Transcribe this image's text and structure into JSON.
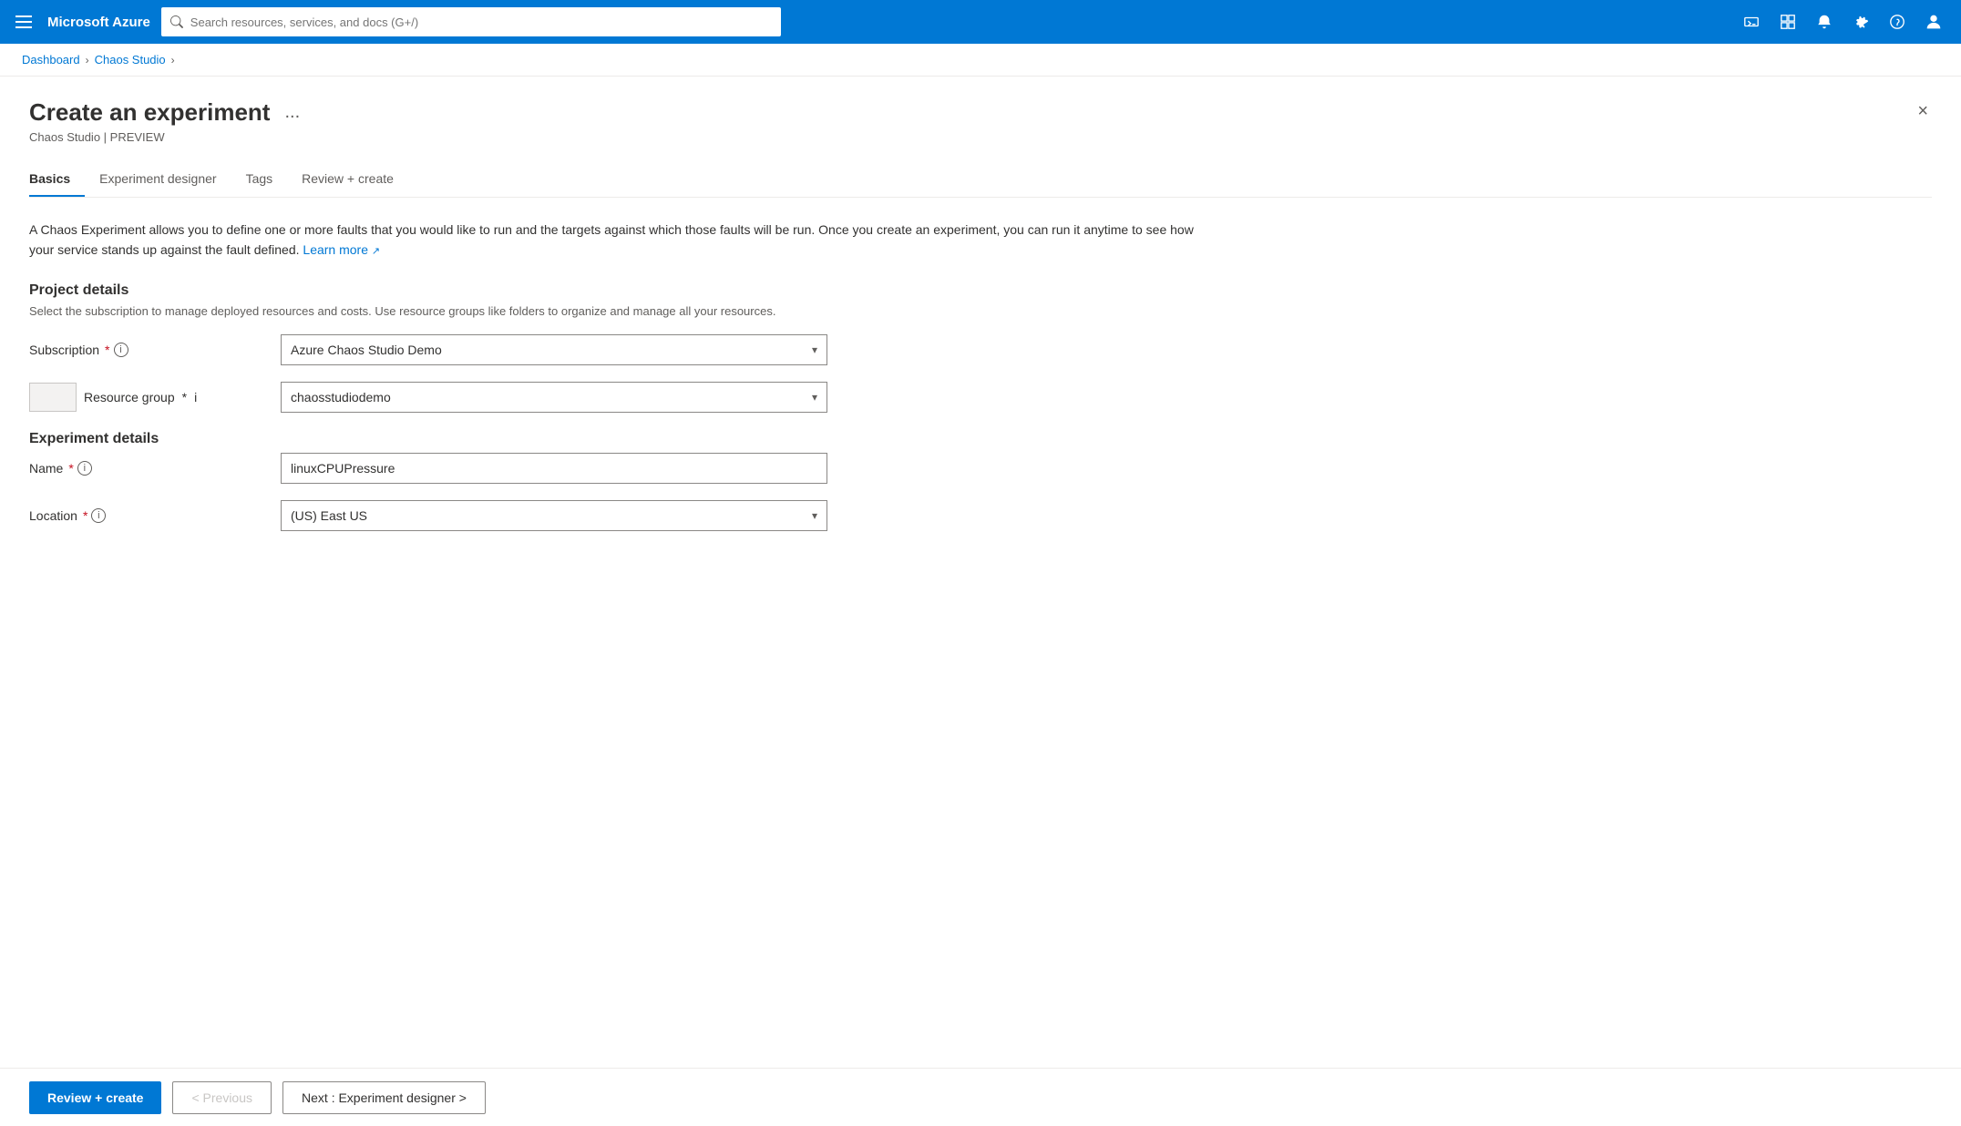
{
  "topnav": {
    "brand": "Microsoft Azure",
    "search_placeholder": "Search resources, services, and docs (G+/)"
  },
  "breadcrumb": {
    "items": [
      "Dashboard",
      "Chaos Studio"
    ]
  },
  "page": {
    "title": "Create an experiment",
    "subtitle": "Chaos Studio | PREVIEW",
    "menu_label": "...",
    "close_label": "×"
  },
  "tabs": [
    {
      "label": "Basics",
      "active": true
    },
    {
      "label": "Experiment designer",
      "active": false
    },
    {
      "label": "Tags",
      "active": false
    },
    {
      "label": "Review + create",
      "active": false
    }
  ],
  "description": {
    "text": "A Chaos Experiment allows you to define one or more faults that you would like to run and the targets against which those faults will be run. Once you create an experiment, you can run it anytime to see how your service stands up against the fault defined.",
    "link_text": "Learn more",
    "link_icon": "↗"
  },
  "project_details": {
    "title": "Project details",
    "subtitle": "Select the subscription to manage deployed resources and costs. Use resource groups like folders to organize and manage all your resources.",
    "subscription_label": "Subscription",
    "subscription_value": "Azure Chaos Studio Demo",
    "resource_group_label": "Resource group",
    "resource_group_value": "chaosstudiodemo"
  },
  "experiment_details": {
    "title": "Experiment details",
    "name_label": "Name",
    "name_value": "linuxCPUPressure",
    "location_label": "Location",
    "location_value": "(US) East US"
  },
  "buttons": {
    "review_create": "Review + create",
    "previous": "< Previous",
    "next": "Next : Experiment designer >"
  }
}
